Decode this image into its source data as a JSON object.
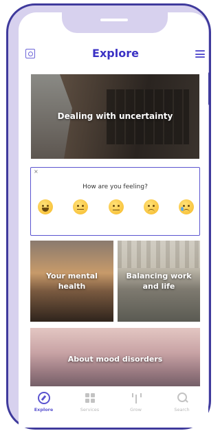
{
  "header": {
    "title": "Explore",
    "left_icon": "scan-frame-icon",
    "right_icon": "hamburger-menu-icon"
  },
  "cards": {
    "uncertainty": "Dealing with uncertainty",
    "mental_health": "Your mental health",
    "balancing": "Balancing work and life",
    "mood_disorders": "About mood disorders"
  },
  "mood_check": {
    "close": "×",
    "question": "How are you feeling?",
    "options": [
      "very-happy-emoji",
      "happy-emoji",
      "neutral-emoji",
      "sad-emoji",
      "crying-emoji"
    ]
  },
  "tabs": [
    {
      "label": "Explore",
      "icon": "compass-icon",
      "active": true
    },
    {
      "label": "Services",
      "icon": "grid-icon",
      "active": false
    },
    {
      "label": "Grow",
      "icon": "sprout-icon",
      "active": false
    },
    {
      "label": "Search",
      "icon": "search-icon",
      "active": false
    }
  ],
  "colors": {
    "accent": "#3b32c4",
    "frame": "#3f3a9c",
    "frame_fill": "#d7d1ee",
    "inactive_tab": "#b8b8b8"
  }
}
